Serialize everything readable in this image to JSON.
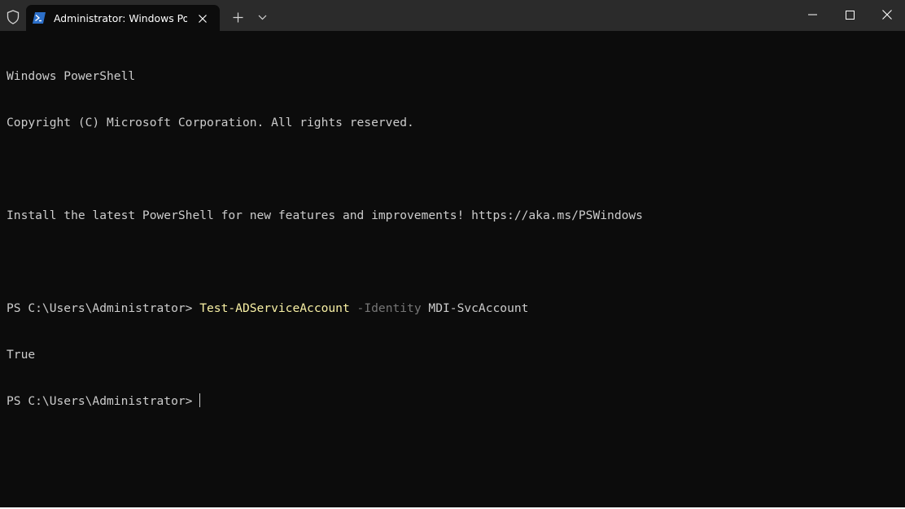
{
  "window": {
    "tab_title": "Administrator: Windows PowerShell",
    "icons": {
      "shield": "shield-icon",
      "tab": "powershell-icon",
      "close_tab": "close-icon",
      "new_tab": "plus-icon",
      "dropdown": "chevron-down-icon",
      "minimize": "minimize-icon",
      "maximize": "maximize-icon",
      "close": "close-icon"
    }
  },
  "terminal": {
    "header_line1": "Windows PowerShell",
    "header_line2": "Copyright (C) Microsoft Corporation. All rights reserved.",
    "install_msg": "Install the latest PowerShell for new features and improvements! https://aka.ms/PSWindows",
    "prompt": "PS C:\\Users\\Administrator> ",
    "command": "Test-ADServiceAccount",
    "param_name": "-Identity",
    "param_value": "MDI-SvcAccount",
    "output": "True"
  },
  "colors": {
    "background": "#0c0c0c",
    "titlebar": "#2b2b2b",
    "text": "#cccccc",
    "command": "#f9f1a5",
    "parameter": "#767676"
  }
}
